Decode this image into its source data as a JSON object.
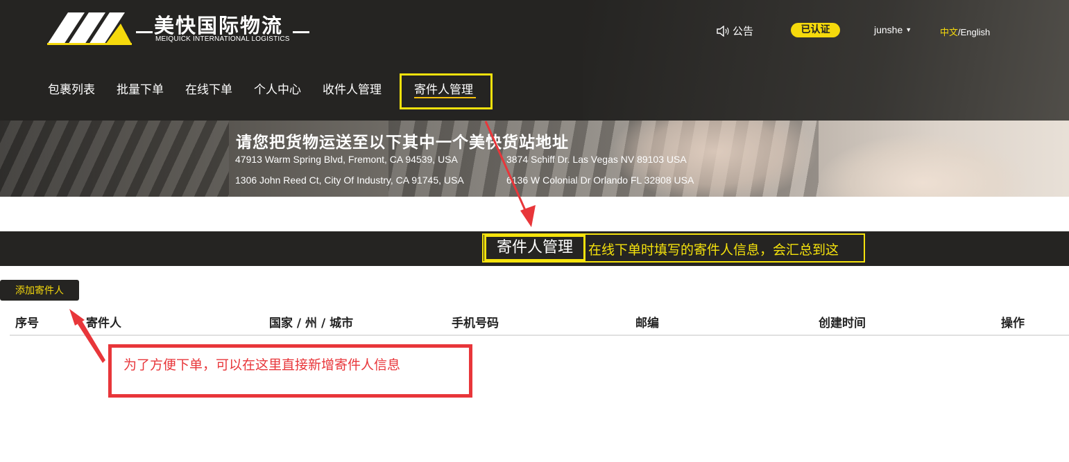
{
  "header": {
    "logo_title": "美快国际物流",
    "logo_subtitle": "MEIQUICK INTERNATIONAL LOGISTICS",
    "notice_label": "公告",
    "verified_badge": "已认证",
    "username": "junshe",
    "lang_zh": "中文",
    "lang_sep": "/",
    "lang_en": "English"
  },
  "nav": {
    "items": [
      {
        "label": "包裹列表"
      },
      {
        "label": "批量下单"
      },
      {
        "label": "在线下单"
      },
      {
        "label": "个人中心"
      },
      {
        "label": "收件人管理"
      }
    ],
    "active_label": "寄件人管理"
  },
  "banner": {
    "title": "请您把货物运送至以下其中一个美快货站地址",
    "addresses": [
      "47913 Warm Spring Blvd, Fremont, CA 94539, USA",
      "3874 Schiff Dr. Las Vegas NV 89103 USA",
      "1306 John Reed Ct, City Of Industry, CA 91745, USA",
      "6136 W Colonial Dr Orlando FL 32808 USA"
    ]
  },
  "section": {
    "title": "寄件人管理",
    "annotation": "在线下单时填写的寄件人信息，会汇总到这"
  },
  "actions": {
    "add_sender": "添加寄件人"
  },
  "table": {
    "columns": [
      "序号",
      "寄件人",
      "国家 / 州 / 城市",
      "手机号码",
      "邮编",
      "创建时间",
      "操作"
    ],
    "rows": []
  },
  "callout": {
    "text": "为了方便下单，可以在这里直接新增寄件人信息"
  },
  "colors": {
    "header_bg": "#252422",
    "accent_yellow": "#f5e20c",
    "annotation_red": "#e8363a"
  }
}
